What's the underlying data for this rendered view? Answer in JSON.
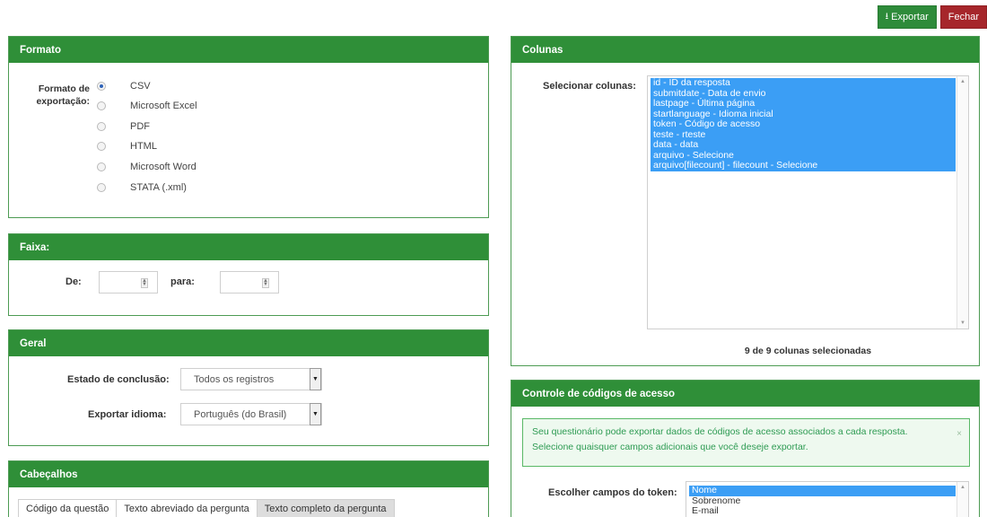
{
  "toolbar": {
    "export_label": "Exportar",
    "close_label": "Fechar"
  },
  "formato": {
    "title": "Formato",
    "label": "Formato de exportação:",
    "options": [
      {
        "label": "CSV",
        "checked": true
      },
      {
        "label": "Microsoft Excel",
        "checked": false
      },
      {
        "label": "PDF",
        "checked": false
      },
      {
        "label": "HTML",
        "checked": false
      },
      {
        "label": "Microsoft Word",
        "checked": false
      },
      {
        "label": "STATA (.xml)",
        "checked": false
      }
    ]
  },
  "faixa": {
    "title": "Faixa:",
    "from_label": "De:",
    "to_label": "para:",
    "from_value": "",
    "to_value": ""
  },
  "geral": {
    "title": "Geral",
    "status_label": "Estado de conclusão:",
    "status_value": "Todos os registros",
    "language_label": "Exportar idioma:",
    "language_value": "Português (do Brasil)"
  },
  "cabecalhos": {
    "title": "Cabeçalhos",
    "tabs": [
      {
        "label": "Código da questão",
        "active": false
      },
      {
        "label": "Texto abreviado da pergunta",
        "active": false
      },
      {
        "label": "Texto completo da pergunta",
        "active": true
      }
    ]
  },
  "colunas": {
    "title": "Colunas",
    "select_label": "Selecionar colunas:",
    "items": [
      "id - ID da resposta",
      "submitdate - Data de envio",
      "lastpage - Última página",
      "startlanguage - Idioma inicial",
      "token - Código de acesso",
      "teste - rteste",
      "data - data",
      "arquivo - Selecione",
      "arquivo[filecount] - filecount - Selecione"
    ],
    "summary": "9 de 9 colunas selecionadas"
  },
  "controle": {
    "title": "Controle de códigos de acesso",
    "alert_text": "Seu questionário pode exportar dados de códigos de acesso associados a cada resposta. Selecione quaisquer campos adicionais que você deseje exportar.",
    "alert_close": "×",
    "fields_label": "Escolher campos do token:",
    "fields": [
      {
        "label": "Nome",
        "selected": true
      },
      {
        "label": "Sobrenome",
        "selected": false
      },
      {
        "label": "E-mail",
        "selected": false
      }
    ]
  },
  "colors": {
    "panel_header": "#2f8f38",
    "export_button": "#2e8b3a",
    "close_button": "#a6262b",
    "selection": "#3b9ef5"
  }
}
